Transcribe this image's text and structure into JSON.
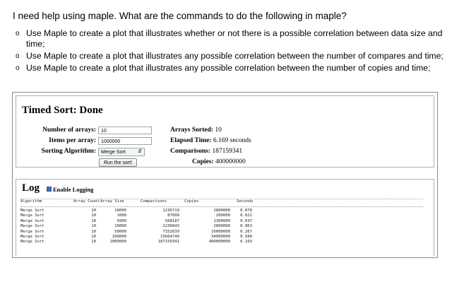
{
  "question": {
    "title": "I need help using maple. What are the commands to do the following in maple?",
    "bullet_glyph": "o",
    "items": [
      "Use Maple to create a plot that illustrates whether or not there is a possible correlation between data size and time;",
      "Use Maple to create a plot that illustrates any possible correlation between the number of compares and time;",
      "Use Maple to create a plot that illustrates any possible correlation between the number of copies and time;"
    ]
  },
  "timed_sort": {
    "title": "Timed Sort: Done",
    "num_arrays_label": "Number of arrays:",
    "num_arrays_value": "10",
    "items_label": "Items per array:",
    "items_value": "1000000",
    "algorithm_label": "Sorting Algorithm:",
    "algorithm_value": "Merge Sort",
    "run_button": "Run the sort!",
    "stats": {
      "arrays_sorted_label": "Arrays Sorted:",
      "arrays_sorted_value": "10",
      "elapsed_label": "Elapsed Time:",
      "elapsed_value": "6.169 seconds",
      "comparisons_label": "Comparisons:",
      "comparisons_value": "187159341",
      "copies_label": "Copies:",
      "copies_value": "400000000"
    }
  },
  "log": {
    "title": "Log",
    "enable_label": "Enable Logging",
    "enable_checked": true,
    "columns": [
      "Algorithm",
      "Array Count",
      "Array Size",
      "Comparisons",
      "Copies",
      "Seconds"
    ],
    "rows": [
      [
        "Merge Sort",
        "10",
        "10000",
        "1236719",
        "2800000",
        "0.070"
      ],
      [
        "Merge Sort",
        "10",
        "1000",
        "87099",
        "200000",
        "0.021"
      ],
      [
        "Merge Sort",
        "10",
        "5000",
        "568187",
        "1300000",
        "0.037"
      ],
      [
        "Merge Sort",
        "10",
        "10000",
        "1236843",
        "2800000",
        "0.063"
      ],
      [
        "Merge Sort",
        "10",
        "50000",
        "7332639",
        "16000000",
        "0.267"
      ],
      [
        "Merge Sort",
        "10",
        "100000",
        "15664749",
        "34000000",
        "0.580"
      ],
      [
        "Merge Sort",
        "10",
        "1000000",
        "187159341",
        "400000000",
        "6.169"
      ]
    ]
  }
}
